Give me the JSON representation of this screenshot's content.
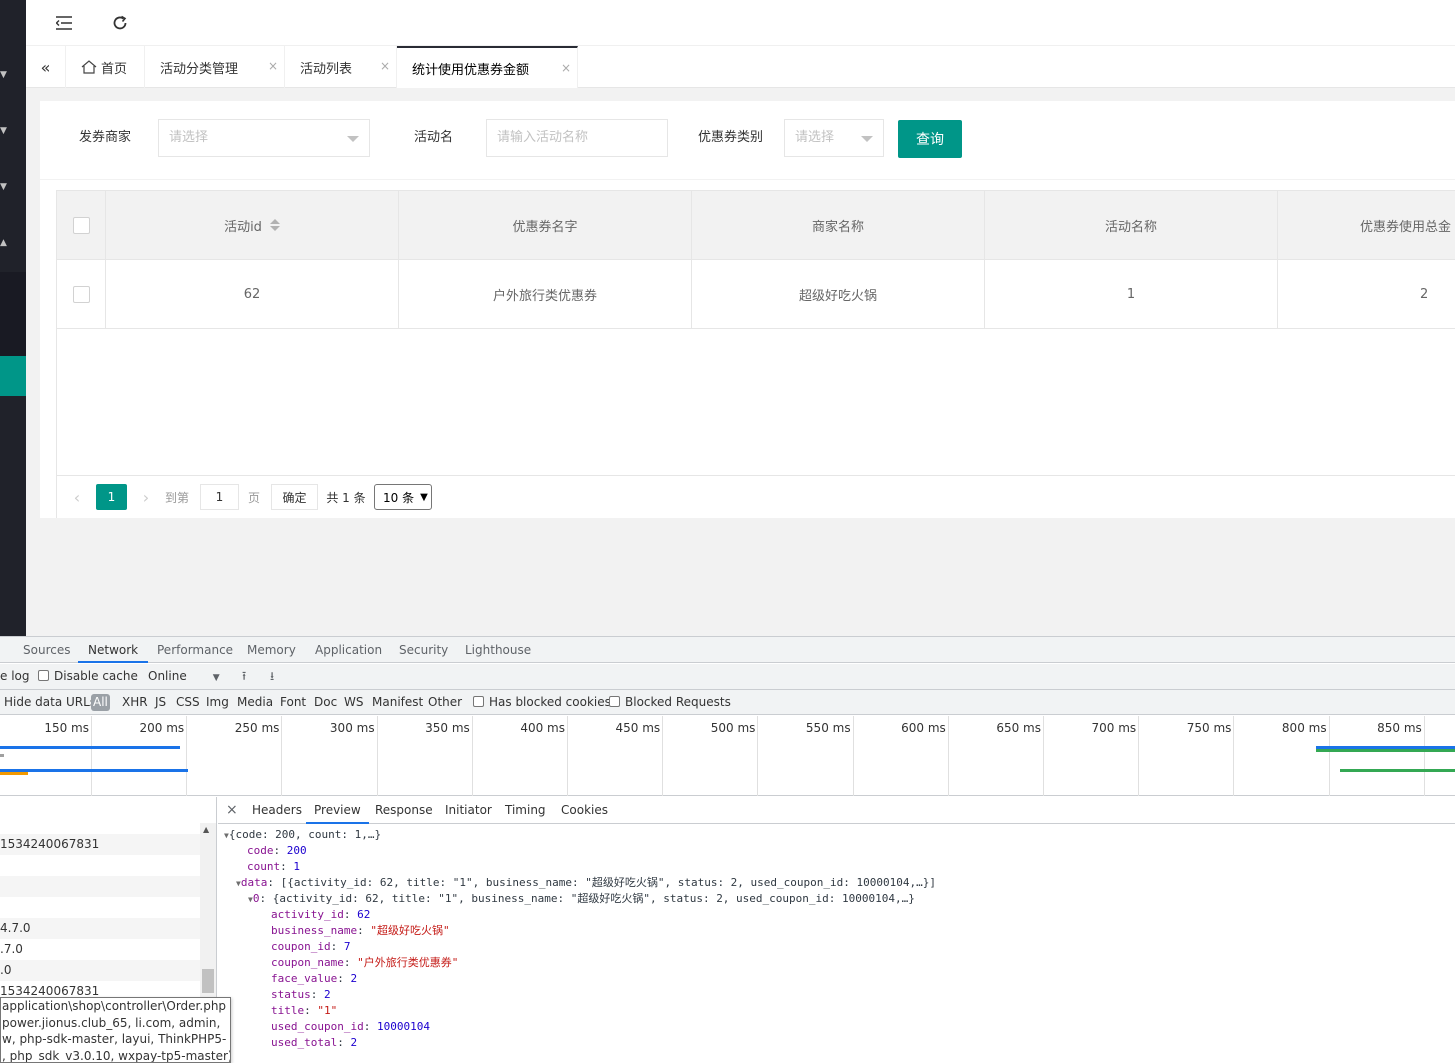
{
  "header": {
    "menu_icon": "menu-fold-icon",
    "refresh_icon": "refresh-icon"
  },
  "tabs": {
    "nav_icon": "double-chevron-left-icon",
    "items": [
      {
        "label": "首页",
        "icon": "home-icon"
      },
      {
        "label": "活动分类管理",
        "close": "×"
      },
      {
        "label": "活动列表",
        "close": "×"
      },
      {
        "label": "统计使用优惠券金额",
        "close": "×",
        "active": true
      }
    ]
  },
  "filters": {
    "merchant_label": "发券商家",
    "merchant_placeholder": "请选择",
    "activity_label": "活动名",
    "activity_placeholder": "请输入活动名称",
    "coupon_type_label": "优惠券类别",
    "coupon_type_placeholder": "请选择",
    "query_button": "查询"
  },
  "table": {
    "columns": [
      "活动id",
      "优惠券名字",
      "商家名称",
      "活动名称",
      "优惠券使用总金"
    ],
    "rows": [
      {
        "activity_id": "62",
        "coupon_name": "户外旅行类优惠券",
        "business_name": "超级好吃火锅",
        "activity_name": "1",
        "total": "2"
      }
    ]
  },
  "pagination": {
    "current": "1",
    "goto_label": "到第",
    "goto_value": "1",
    "page_unit": "页",
    "confirm": "确定",
    "total": "共 1 条",
    "per_page": "10 条"
  },
  "devtools": {
    "tabs": [
      "Sources",
      "Network",
      "Performance",
      "Memory",
      "Application",
      "Security",
      "Lighthouse"
    ],
    "active_tab": "Network",
    "toolbar": {
      "preserve_log": "e log",
      "disable_cache": "Disable cache",
      "throttle": "Online"
    },
    "filter": {
      "hide_data_urls": "Hide data URLs",
      "types": [
        "All",
        "XHR",
        "JS",
        "CSS",
        "Img",
        "Media",
        "Font",
        "Doc",
        "WS",
        "Manifest",
        "Other"
      ],
      "has_blocked_cookies": "Has blocked cookies",
      "blocked_requests": "Blocked Requests"
    },
    "timeline_ticks": [
      "150 ms",
      "200 ms",
      "250 ms",
      "300 ms",
      "350 ms",
      "400 ms",
      "450 ms",
      "500 ms",
      "550 ms",
      "600 ms",
      "650 ms",
      "700 ms",
      "750 ms",
      "800 ms",
      "850 ms"
    ],
    "request_rows": [
      "1534240067831",
      "",
      "",
      "",
      "4.7.0",
      ".7.0",
      ".0",
      "1534240067831"
    ],
    "tooltip_lines": [
      "application\\shop\\controller\\Order.php",
      "power.jionus.club_65, li.com, admin,",
      "w, php-sdk-master, layui, ThinkPHP5-",
      ", php_sdk_v3.0.10, wxpay-tp5-master)"
    ],
    "detail_tabs": [
      "Headers",
      "Preview",
      "Response",
      "Initiator",
      "Timing",
      "Cookies"
    ],
    "active_detail_tab": "Preview",
    "preview": {
      "root": "{code: 200, count: 1,…}",
      "code": "200",
      "count": "1",
      "data_summary": "[{activity_id: 62, title: \"1\", business_name: \"超级好吃火锅\", status: 2, used_coupon_id: 10000104,…}]",
      "item_summary": "{activity_id: 62, title: \"1\", business_name: \"超级好吃火锅\", status: 2, used_coupon_id: 10000104,…}",
      "activity_id": "62",
      "business_name": "\"超级好吃火锅\"",
      "coupon_id": "7",
      "coupon_name": "\"户外旅行类优惠券\"",
      "face_value": "2",
      "status": "2",
      "title": "\"1\"",
      "used_coupon_id": "10000104",
      "used_total": "2"
    }
  },
  "colors": {
    "primary": "#009688",
    "sidebar": "#20222a",
    "devtools_accent": "#1a73e8"
  }
}
